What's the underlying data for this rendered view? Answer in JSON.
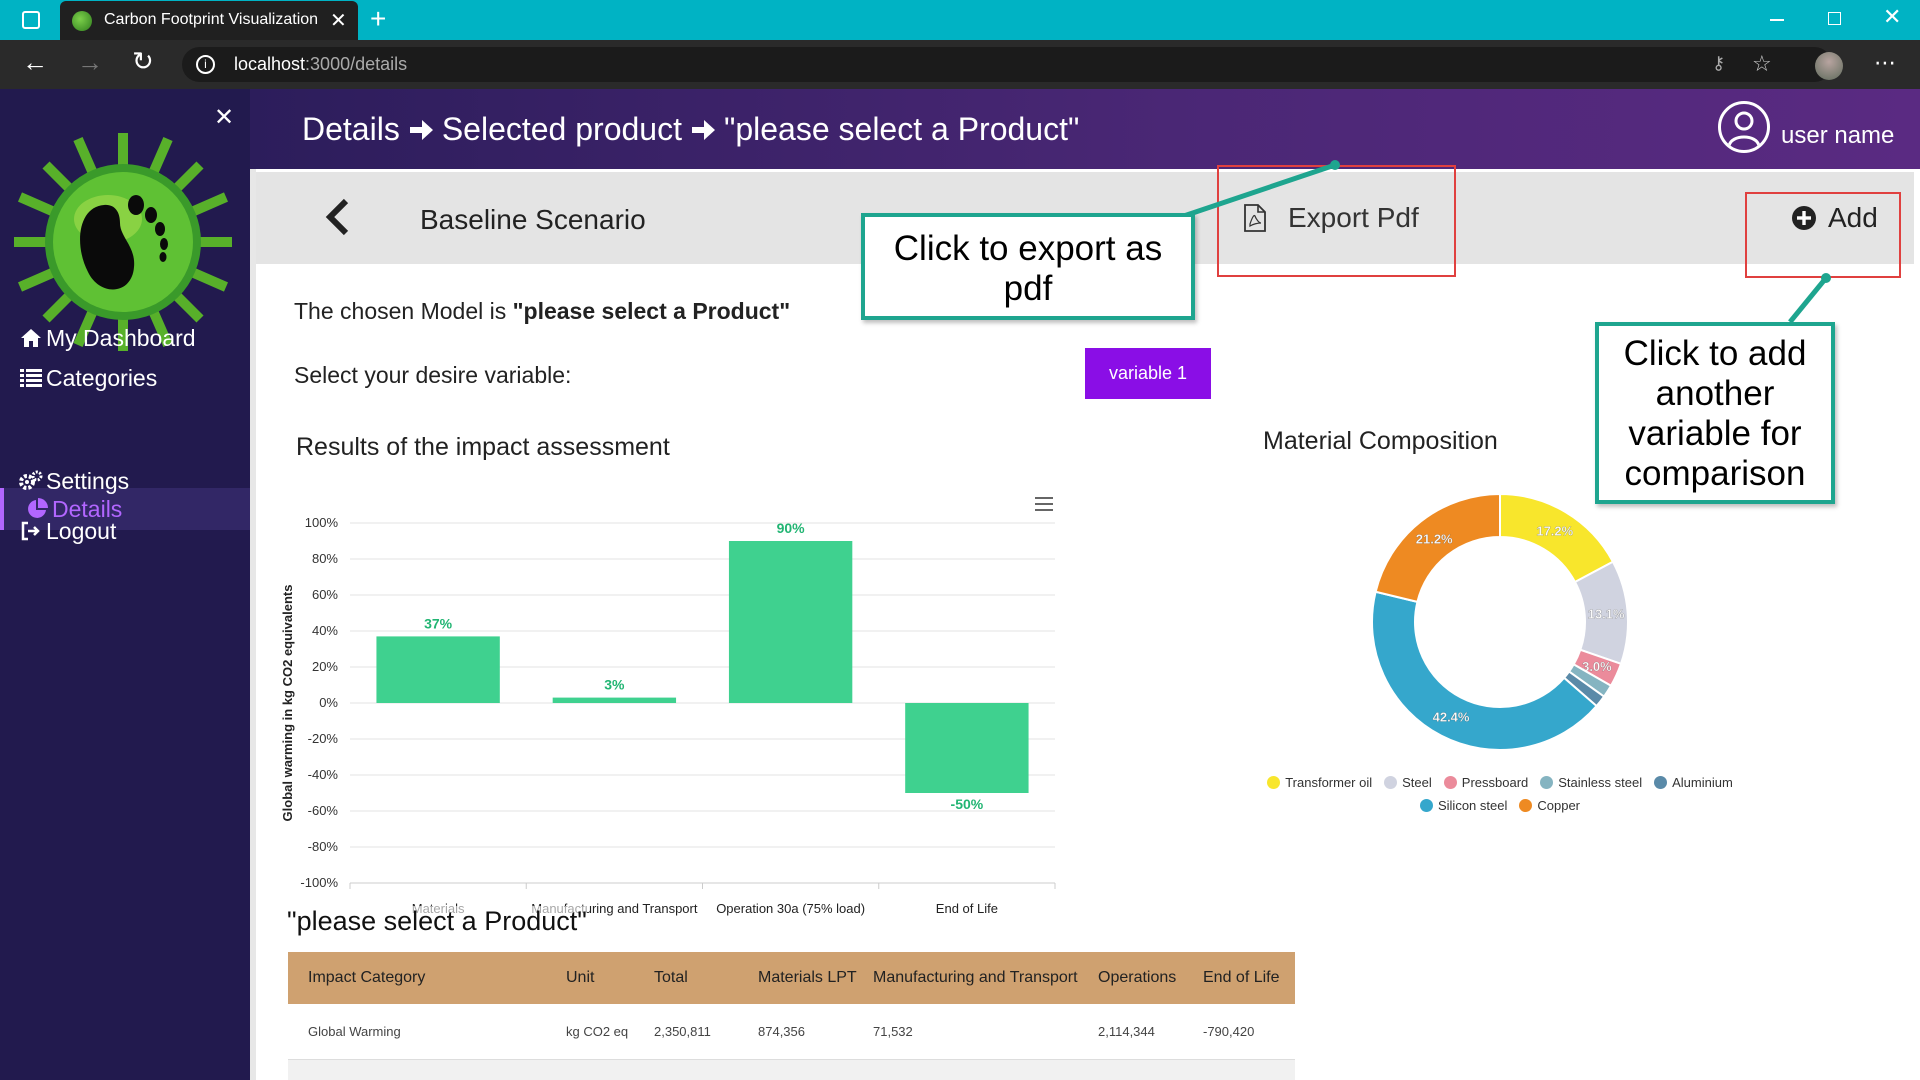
{
  "browser": {
    "tab_title": "Carbon Footprint Visualization",
    "url_host": "localhost",
    "url_rest": ":3000/details"
  },
  "sidebar": {
    "items": [
      {
        "label": "My Dashboard",
        "icon": "home-icon"
      },
      {
        "label": "Categories",
        "icon": "list-icon"
      },
      {
        "label": "Details",
        "icon": "pie-chart-icon",
        "active": true
      },
      {
        "label": "Settings",
        "icon": "gears-icon"
      },
      {
        "label": "Logout",
        "icon": "logout-icon"
      }
    ]
  },
  "header": {
    "crumb1": "Details",
    "crumb2": "Selected product",
    "crumb3": "\"please select a Product\"",
    "user_name": "user name"
  },
  "toolbar": {
    "title": "Baseline Scenario",
    "export_label": "Export Pdf",
    "add_label": "Add"
  },
  "main": {
    "model_prefix": "The chosen Model is ",
    "model_value": "\"please select a Product\"",
    "variable_prompt": "Select your desire variable:",
    "variable_button": "variable 1"
  },
  "callouts": {
    "export": "Click to export as pdf",
    "add": "Click to add another variable for comparison"
  },
  "colors": {
    "bar": "#3fd18f",
    "accent": "#8a0ee6",
    "table_header": "#cfa170",
    "callout_border": "#1ea58f"
  },
  "chart_data": [
    {
      "type": "bar",
      "title": "Results of the impact assessment",
      "ylabel": "Global warming in kg CO2 equivalents",
      "categories": [
        "Materials",
        "Manufacturing and Transport",
        "Operation 30a (75% load)",
        "End of Life"
      ],
      "values": [
        37,
        3,
        90,
        -50
      ],
      "labels": [
        "37%",
        "3%",
        "90%",
        "-50%"
      ],
      "ylim": [
        -100,
        100
      ],
      "yticks": [
        "100%",
        "80%",
        "60%",
        "40%",
        "20%",
        "0%",
        "-20%",
        "-40%",
        "-60%",
        "-80%",
        "-100%"
      ],
      "grid": true
    },
    {
      "type": "pie",
      "title": "Material Composition",
      "donut": true,
      "slices": [
        {
          "name": "Transformer oil",
          "value": 17.2,
          "label": "17.2%",
          "color": "#f8e62c"
        },
        {
          "name": "Steel",
          "value": 13.1,
          "label": "13.1%",
          "color": "#d0d3e0"
        },
        {
          "name": "Pressboard",
          "value": 3.0,
          "label": "3.0%",
          "color": "#eb8b9b"
        },
        {
          "name": "Stainless steel",
          "value": 1.6,
          "label": "",
          "color": "#85b4c1"
        },
        {
          "name": "Aluminium",
          "value": 1.5,
          "label": "",
          "color": "#5a8aa8"
        },
        {
          "name": "Silicon steel",
          "value": 42.4,
          "label": "42.4%",
          "color": "#35a7cc"
        },
        {
          "name": "Copper",
          "value": 21.2,
          "label": "21.2%",
          "color": "#ee8a22"
        }
      ],
      "legend_position": "bottom"
    }
  ],
  "table": {
    "title": "\"please select a Product\"",
    "headers": [
      "Impact Category",
      "Unit",
      "Total",
      "Materials LPT",
      "Manufacturing and Transport",
      "Operations",
      "End of Life"
    ],
    "rows": [
      [
        "Global Warming",
        "kg CO2 eq",
        "2,350,811",
        "874,356",
        "71,532",
        "2,114,344",
        "-790,420"
      ]
    ]
  }
}
